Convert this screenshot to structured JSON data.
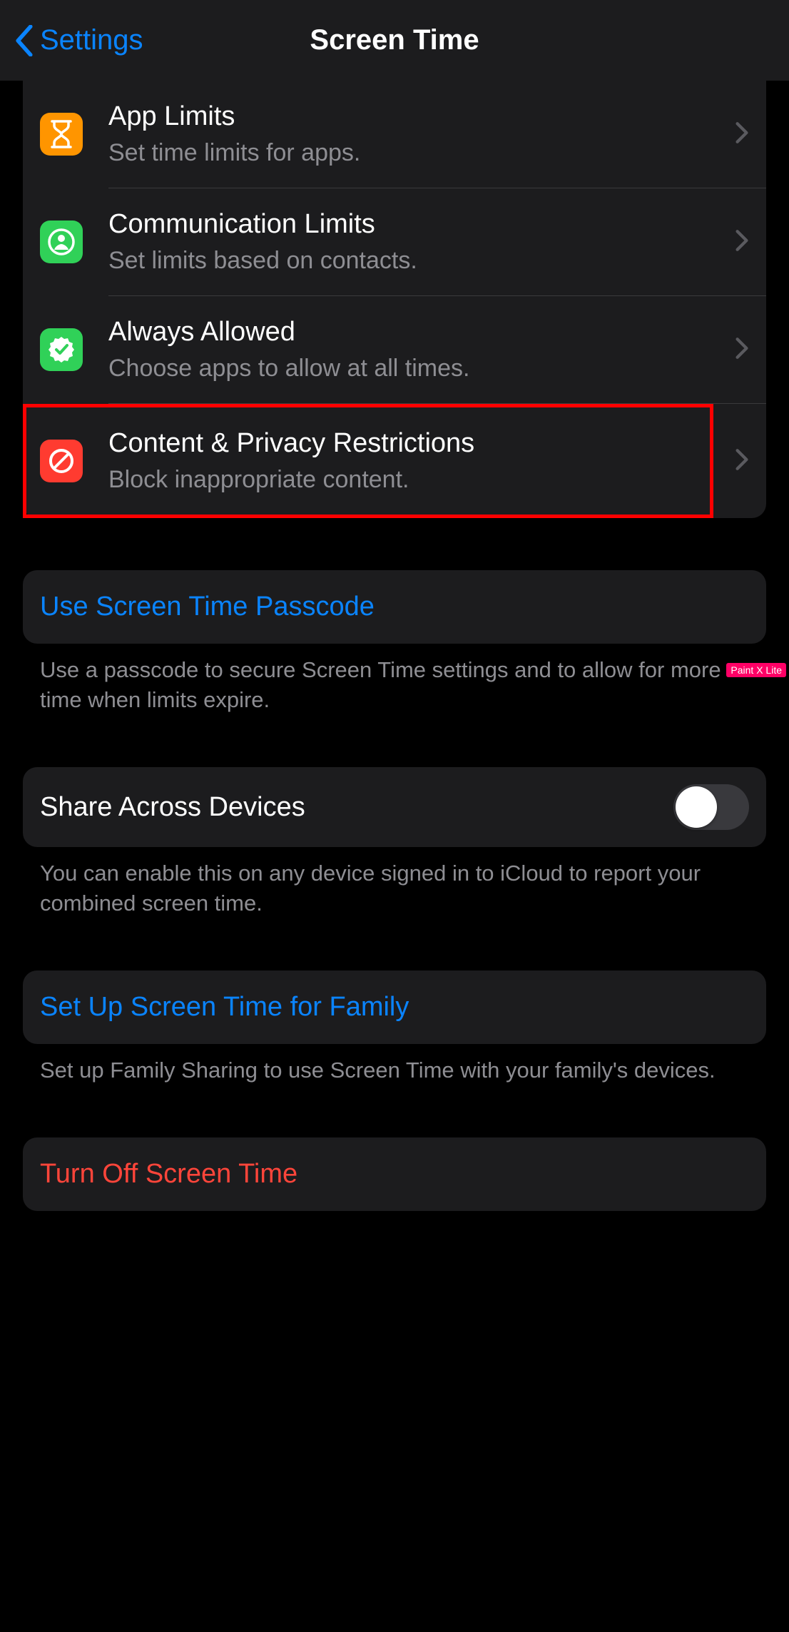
{
  "nav": {
    "back_label": "Settings",
    "title": "Screen Time"
  },
  "rows": {
    "app_limits": {
      "title": "App Limits",
      "sub": "Set time limits for apps."
    },
    "communication": {
      "title": "Communication Limits",
      "sub": "Set limits based on contacts."
    },
    "always": {
      "title": "Always Allowed",
      "sub": "Choose apps to allow at all times."
    },
    "content": {
      "title": "Content & Privacy Restrictions",
      "sub": "Block inappropriate content."
    }
  },
  "passcode": {
    "link": "Use Screen Time Passcode",
    "footer": "Use a passcode to secure Screen Time settings and to allow for more time when limits expire."
  },
  "share": {
    "label": "Share Across Devices",
    "footer": "You can enable this on any device signed in to iCloud to report your combined screen time.",
    "enabled": false
  },
  "family": {
    "link": "Set Up Screen Time for Family",
    "footer": "Set up Family Sharing to use Screen Time with your family's devices."
  },
  "turn_off": {
    "label": "Turn Off Screen Time"
  },
  "watermark": "Paint X Lite"
}
